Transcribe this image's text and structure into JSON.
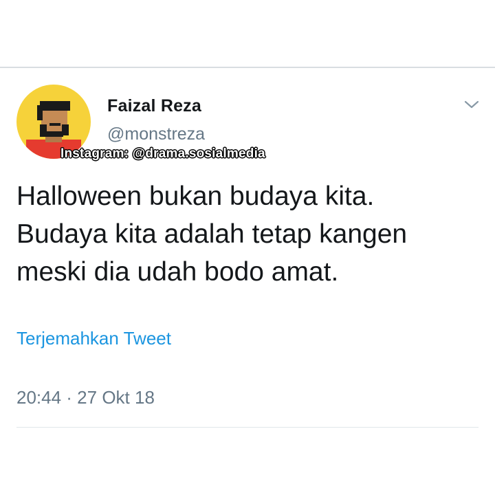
{
  "tweet": {
    "display_name": "Faizal Reza",
    "handle": "@monstreza",
    "watermark": "Instagram: @drama.sosialmedia",
    "text_lines": [
      "Halloween bukan budaya kita.",
      "Budaya kita adalah tetap kangen",
      "meski dia udah bodo amat."
    ],
    "translate_label": "Terjemahkan Tweet",
    "timestamp": "20:44 · 27 Okt 18",
    "menu_icon": "chevron-down-icon"
  },
  "colors": {
    "avatar_bg": "#f6d23a",
    "link": "#1b95e0",
    "secondary_text": "#657786",
    "primary_text": "#14171a"
  }
}
